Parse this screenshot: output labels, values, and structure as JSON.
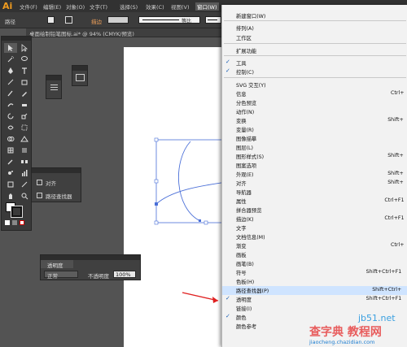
{
  "app": {
    "logo": "Ai"
  },
  "menubar": {
    "items": [
      "文件(F)",
      "编辑(E)",
      "对象(O)",
      "文字(T)",
      "选择(S)",
      "效果(C)",
      "视图(V)",
      "窗口(W)"
    ]
  },
  "controlbar": {
    "label": "路径",
    "stroke_label": "描边",
    "profile1": "等比",
    "profile2": "基"
  },
  "document": {
    "tab_title": "桌面绘制铅笔图标.ai* @ 94% (CMYK/预览)"
  },
  "align_panel": {
    "items": [
      "对齐",
      "路径查找器"
    ]
  },
  "transparency_panel": {
    "title": "透明度",
    "blend_mode": "正常",
    "opacity_label": "不透明度",
    "opacity_value": "100%"
  },
  "window_menu": {
    "items": [
      {
        "label": "新建窗口(W)",
        "shortcut": "",
        "checked": false
      },
      {
        "label": "排列(A)",
        "shortcut": "",
        "checked": false
      },
      {
        "label": "工作区",
        "shortcut": "",
        "checked": false
      },
      {
        "label": "扩展功能",
        "shortcut": "",
        "checked": false
      },
      {
        "label": "工具",
        "shortcut": "",
        "checked": true
      },
      {
        "label": "控制(C)",
        "shortcut": "",
        "checked": true
      },
      {
        "label": "SVG 交互(Y)",
        "shortcut": "",
        "checked": false
      },
      {
        "label": "信息",
        "shortcut": "Ctrl+",
        "checked": false
      },
      {
        "label": "分色预览",
        "shortcut": "",
        "checked": false
      },
      {
        "label": "动作(N)",
        "shortcut": "",
        "checked": false
      },
      {
        "label": "变换",
        "shortcut": "Shift+",
        "checked": false
      },
      {
        "label": "变量(R)",
        "shortcut": "",
        "checked": false
      },
      {
        "label": "图像描摹",
        "shortcut": "",
        "checked": false
      },
      {
        "label": "图层(L)",
        "shortcut": "",
        "checked": false
      },
      {
        "label": "图形样式(S)",
        "shortcut": "Shift+",
        "checked": false
      },
      {
        "label": "图案选项",
        "shortcut": "",
        "checked": false
      },
      {
        "label": "外观(E)",
        "shortcut": "Shift+",
        "checked": false
      },
      {
        "label": "对齐",
        "shortcut": "Shift+",
        "checked": false
      },
      {
        "label": "导航器",
        "shortcut": "",
        "checked": false
      },
      {
        "label": "属性",
        "shortcut": "Ctrl+F1",
        "checked": false
      },
      {
        "label": "拼合器预览",
        "shortcut": "",
        "checked": false
      },
      {
        "label": "描边(K)",
        "shortcut": "Ctrl+F1",
        "checked": false
      },
      {
        "label": "文字",
        "shortcut": "",
        "checked": false
      },
      {
        "label": "文档信息(M)",
        "shortcut": "",
        "checked": false
      },
      {
        "label": "渐变",
        "shortcut": "Ctrl+",
        "checked": false
      },
      {
        "label": "画板",
        "shortcut": "",
        "checked": false
      },
      {
        "label": "画笔(B)",
        "shortcut": "",
        "checked": false
      },
      {
        "label": "符号",
        "shortcut": "Shift+Ctrl+F1",
        "checked": false
      },
      {
        "label": "色板(H)",
        "shortcut": "",
        "checked": false
      },
      {
        "label": "路径查找器(P)",
        "shortcut": "Shift+Ctrl+",
        "checked": false
      },
      {
        "label": "透明度",
        "shortcut": "Shift+Ctrl+F1",
        "checked": true
      },
      {
        "label": "链接(I)",
        "shortcut": "",
        "checked": false
      },
      {
        "label": "颜色",
        "shortcut": "",
        "checked": true
      },
      {
        "label": "颜色参考",
        "shortcut": "",
        "checked": false
      }
    ]
  },
  "watermark": {
    "site": "jb51.net",
    "brand": "查字典 教程网",
    "url": "jiaocheng.chazidian.com"
  },
  "colors": {
    "accent_logo": "#f19c1e",
    "arrow": "#e02020",
    "selection": "#4a6fd8"
  }
}
